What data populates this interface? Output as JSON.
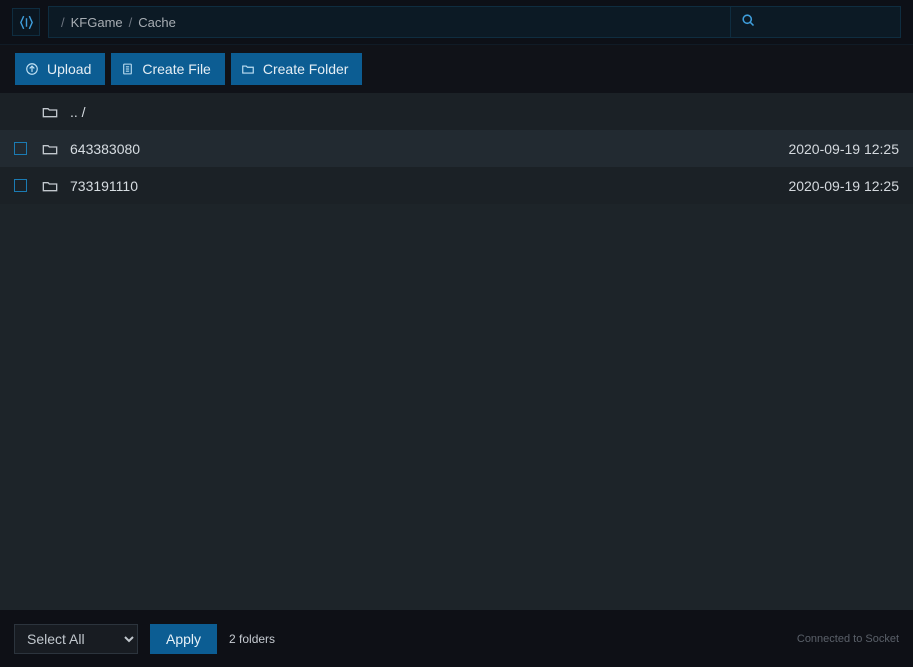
{
  "breadcrumbs": {
    "parts": [
      "KFGame",
      "Cache"
    ]
  },
  "toolbar": {
    "upload_label": "Upload",
    "create_file_label": "Create File",
    "create_folder_label": "Create Folder"
  },
  "listing": {
    "parent_label": ".. /",
    "rows": [
      {
        "name": "643383080",
        "modified": "2020-09-19 12:25"
      },
      {
        "name": "733191110",
        "modified": "2020-09-19 12:25"
      }
    ]
  },
  "footer": {
    "select_all_label": "Select All",
    "apply_label": "Apply",
    "count_text": "2 folders",
    "socket_status": "Connected to Socket"
  }
}
